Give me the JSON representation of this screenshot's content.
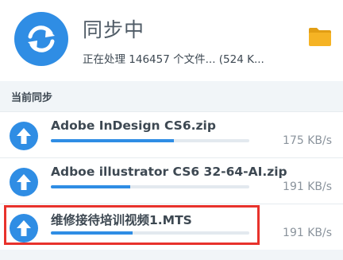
{
  "header": {
    "title": "同步中",
    "subtitle": "正在处理 146457 个文件... (524 K...",
    "sync_icon": "sync-arrows-icon",
    "folder_icon": "folder-icon"
  },
  "section": {
    "label": "当前同步"
  },
  "items": [
    {
      "name": "Adobe InDesign CS6.zip",
      "speed": "175 KB/s",
      "progress": 0.62,
      "icon": "upload-arrow-icon"
    },
    {
      "name": "Adboe illustrator CS6 32-64-AI.zip",
      "speed": "191 KB/s",
      "progress": 0.4,
      "icon": "upload-arrow-icon"
    },
    {
      "name": "维修接待培训视频1.MTS",
      "speed": "191 KB/s",
      "progress": 0.41,
      "icon": "upload-arrow-icon"
    }
  ],
  "colors": {
    "accent": "#2f8de4",
    "highlight_border": "#e8322c",
    "folder": "#f5b324"
  }
}
